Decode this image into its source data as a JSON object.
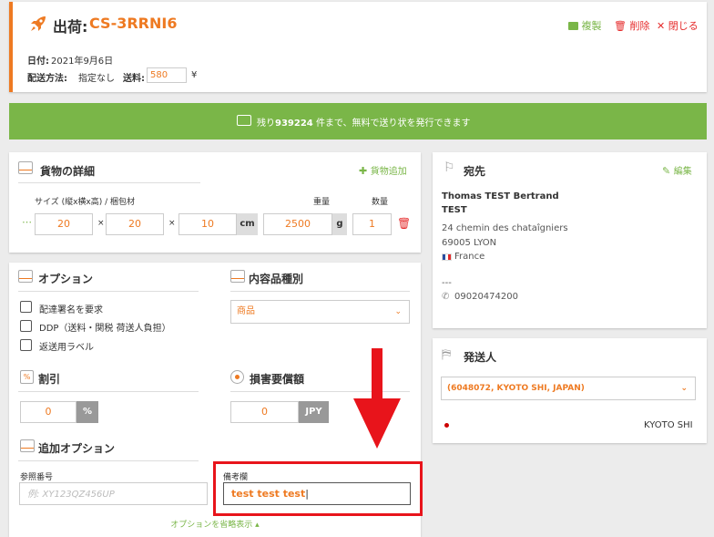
{
  "header": {
    "title_prefix": "出荷:",
    "shipment_id": "CS-3RRNI6",
    "actions": {
      "copy": "複製",
      "delete": "削除",
      "close": "閉じる"
    },
    "date_label": "日付:",
    "date_value": "2021年9月6日",
    "method_label": "配送方法:",
    "method_value": "指定なし",
    "fee_label": "送料:",
    "fee_value": "580",
    "fee_currency": "¥"
  },
  "banner": {
    "prefix": "残り",
    "count": "939224",
    "suffix": "件まで、無料で送り状を発行できます"
  },
  "cargo": {
    "title": "貨物の詳細",
    "add_label": "貨物追加",
    "size_label": "サイズ (縦x横x高) / 梱包材",
    "weight_label": "重量",
    "qty_label": "数量",
    "dims": [
      "20",
      "20",
      "10"
    ],
    "times": "×",
    "dim_unit": "cm",
    "weight": "2500",
    "weight_unit": "g",
    "qty": "1",
    "handle": "⋯"
  },
  "recipient": {
    "title": "宛先",
    "edit_label": "編集",
    "name": "Thomas TEST Bertrand",
    "company": "TEST",
    "address1": "24 chemin des chataîgniers",
    "address2": "69005 LYON",
    "country": "France",
    "dashes": "---",
    "phone": "09020474200"
  },
  "options": {
    "title": "オプション",
    "items": [
      "配達署名を要求",
      "DDP（送料・関税 荷送人負担）",
      "返送用ラベル"
    ],
    "content_type_title": "内容品種別",
    "content_type_value": "商品",
    "discount_title": "割引",
    "discount_value": "0",
    "discount_unit": "%",
    "insurance_title": "損害要償額",
    "insurance_value": "0",
    "insurance_unit": "JPY",
    "extra_title": "追加オプション",
    "reference_label": "参照番号",
    "reference_placeholder": "例: XY123QZ456UP",
    "remarks_label": "備考欄",
    "remarks_value": "test test test",
    "collapse_label": "オプションを省略表示"
  },
  "sender": {
    "title": "発送人",
    "select_value": "(6048072, KYOTO SHI, JAPAN)",
    "city": "KYOTO SHI"
  },
  "colors": {
    "accent": "#ee7a22",
    "green": "#7ab648",
    "red": "#e52b2b",
    "annotation": "#e8141b"
  }
}
